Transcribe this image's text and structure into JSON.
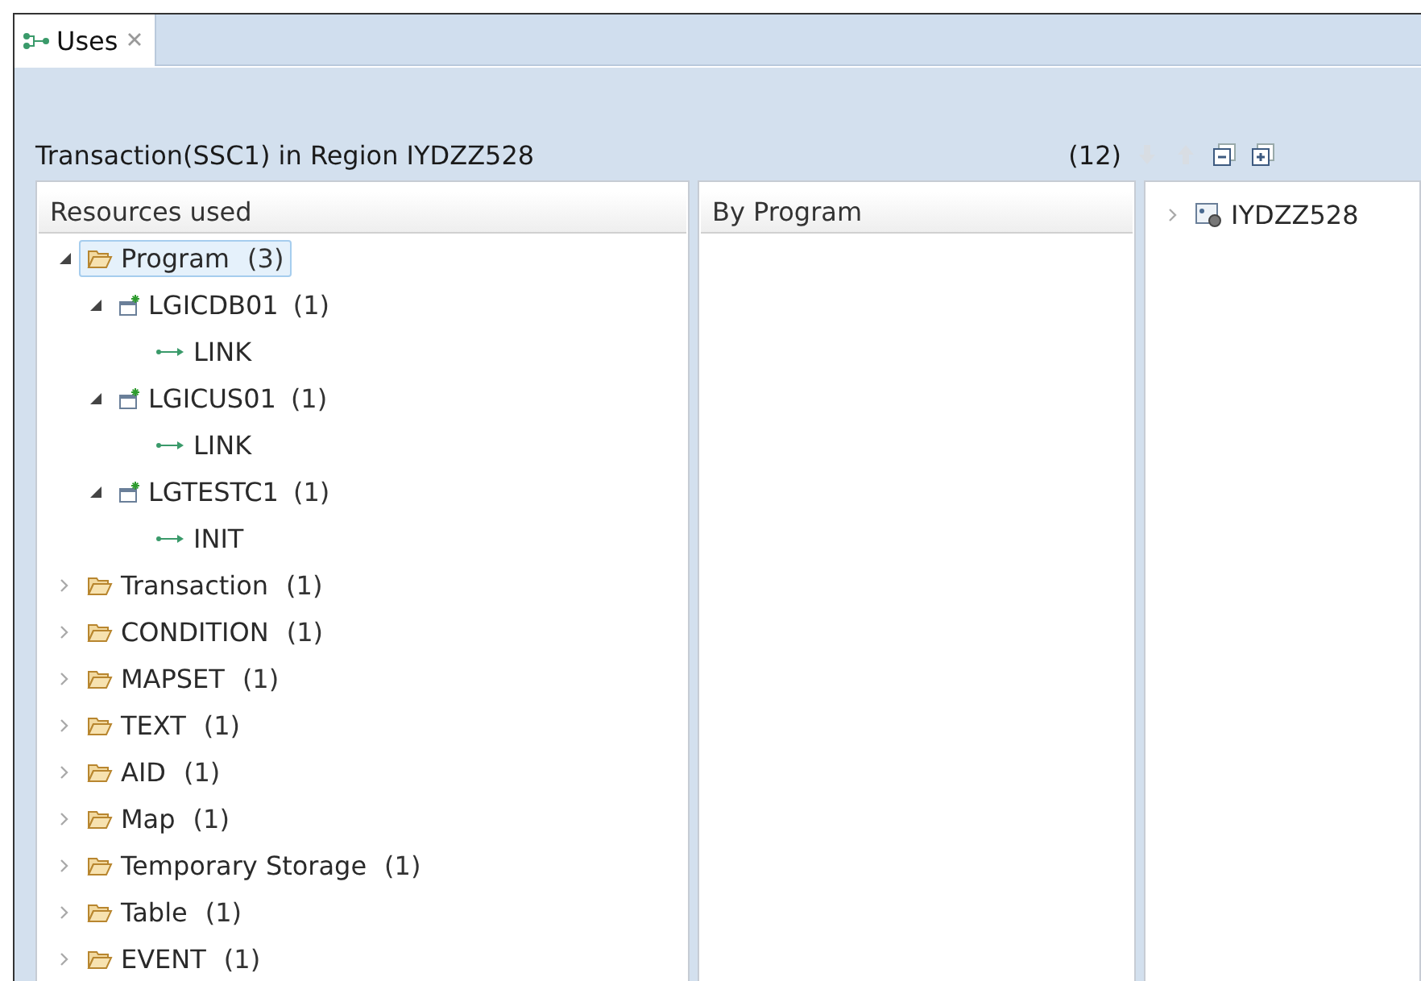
{
  "tab": {
    "label": "Uses",
    "selected": true
  },
  "header": {
    "title": "Transaction(SSC1) in Region IYDZZ528",
    "count": "(12)"
  },
  "toolbar": [
    {
      "kind": "down",
      "disabled": true
    },
    {
      "kind": "up",
      "disabled": true
    },
    {
      "kind": "collapse",
      "disabled": false
    },
    {
      "kind": "expand",
      "disabled": false
    }
  ],
  "resources": {
    "heading": "Resources used",
    "tree": [
      {
        "kind": "folder",
        "label": "Program",
        "count": "(3)",
        "expanded": true,
        "selected": true,
        "children": [
          {
            "kind": "program",
            "label": "LGICDB01",
            "count": "(1)",
            "expanded": true,
            "selected": false,
            "children": [
              {
                "kind": "link",
                "label": "LINK",
                "selected": false
              }
            ]
          },
          {
            "kind": "program",
            "label": "LGICUS01",
            "count": "(1)",
            "expanded": true,
            "selected": false,
            "children": [
              {
                "kind": "link",
                "label": "LINK",
                "selected": false
              }
            ]
          },
          {
            "kind": "program",
            "label": "LGTESTC1",
            "count": "(1)",
            "expanded": true,
            "selected": false,
            "children": [
              {
                "kind": "link",
                "label": "INIT",
                "selected": false
              }
            ]
          }
        ]
      },
      {
        "kind": "folder",
        "label": "Transaction",
        "count": "(1)",
        "expanded": false,
        "selected": false
      },
      {
        "kind": "folder",
        "label": "CONDITION",
        "count": "(1)",
        "expanded": false,
        "selected": false
      },
      {
        "kind": "folder",
        "label": "MAPSET",
        "count": "(1)",
        "expanded": false,
        "selected": false
      },
      {
        "kind": "folder",
        "label": "TEXT",
        "count": "(1)",
        "expanded": false,
        "selected": false
      },
      {
        "kind": "folder",
        "label": "AID",
        "count": "(1)",
        "expanded": false,
        "selected": false
      },
      {
        "kind": "folder",
        "label": "Map",
        "count": "(1)",
        "expanded": false,
        "selected": false
      },
      {
        "kind": "folder",
        "label": "Temporary Storage",
        "count": "(1)",
        "expanded": false,
        "selected": false
      },
      {
        "kind": "folder",
        "label": "Table",
        "count": "(1)",
        "expanded": false,
        "selected": false
      },
      {
        "kind": "folder",
        "label": "EVENT",
        "count": "(1)",
        "expanded": false,
        "selected": false
      }
    ]
  },
  "by_program": {
    "heading": "By Program"
  },
  "regions": {
    "tree": [
      {
        "kind": "region",
        "label": "IYDZZ528",
        "expanded": false,
        "selected": false
      }
    ]
  }
}
